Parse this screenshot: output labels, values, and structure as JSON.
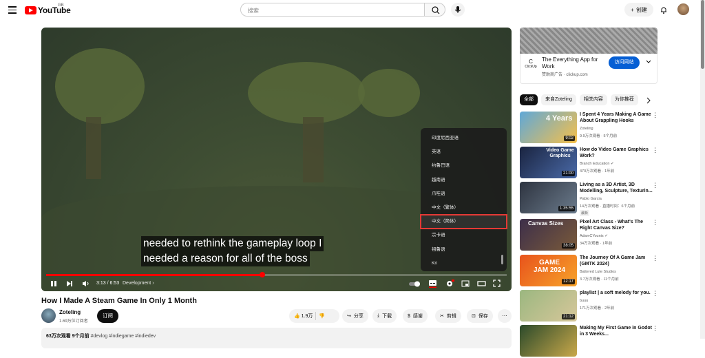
{
  "header": {
    "logo_text": "YouTube",
    "region": "GB",
    "search_placeholder": "搜索",
    "create_label": "创建"
  },
  "player": {
    "subtitle_line1": "needed to rethink the gameplay loop I",
    "subtitle_line2": "needed a reason for all of the boss",
    "current_time": "3:13 / 6:53",
    "chapter": "Development",
    "progress": 0.47,
    "settings_menu": {
      "items": [
        "印度尼西亚语",
        "英语",
        "约鲁巴语",
        "越南语",
        "爪哇语",
        "中文（繁体）",
        "中文（简体）",
        "宗卡语",
        "祖鲁语",
        "Kri"
      ],
      "selected_index": 6
    }
  },
  "video": {
    "title": "How I Made A Steam Game In Only 1 Month",
    "channel": "Zoteling",
    "subscribers": "1.69万位订阅者",
    "subscribe_label": "订阅",
    "like_count": "1.9万",
    "share_label": "分享",
    "download_label": "下载",
    "thanks_label": "感谢",
    "clip_label": "剪辑",
    "save_label": "保存",
    "views": "63万次观看",
    "date": "9个月前",
    "tags": "#devlog #indiegame #indiedev"
  },
  "ad": {
    "logo_label": "ClickUp",
    "title": "The Everything App for Work",
    "sponsor": "赞助商广告 · clickup.com",
    "cta": "访问网站"
  },
  "chips": [
    "全部",
    "来自Zoteling",
    "相关内容",
    "为你推荐"
  ],
  "recommendations": [
    {
      "title": "I Spent 4 Years Making A Game About Grappling Hooks",
      "channel": "Zoteling",
      "meta": "9.9万次观看 · 5个月前",
      "duration": "9:02",
      "thumb_text": "4 Years"
    },
    {
      "title": "How do Video Game Graphics Work?",
      "channel": "Branch Education",
      "meta": "470万次观看 · 1年前",
      "duration": "21:00",
      "thumb_text": "Video Game Graphics"
    },
    {
      "title": "Living as a 3D Artist, 3D Modelling, Sculpture, Texturin...",
      "channel": "Pablo Garcia",
      "meta": "14万次观看 · 直播时间：6个月前",
      "duration": "1:35:55",
      "badge": "最新",
      "thumb_text": ""
    },
    {
      "title": "Pixel Art Class - What's The Right Canvas Size?",
      "channel": "AdamCYounis",
      "meta": "34万次观看 · 1年前",
      "duration": "38:05",
      "thumb_text": "Canvas Sizes"
    },
    {
      "title": "The Journey Of A Game Jam (GMTK 2024)",
      "channel": "Battered Lute Studios",
      "meta": "3.7万次观看 · 11个月前",
      "duration": "12:17",
      "thumb_text": "GAME JAM 2024"
    },
    {
      "title": "playlist | a soft melody for you.",
      "channel": "buuu",
      "meta": "171万次观看 · 2年前",
      "duration": "21:12",
      "thumb_text": ""
    },
    {
      "title": "Making My First Game in Godot in 3 Weeks...",
      "channel": "",
      "meta": "",
      "duration": "",
      "thumb_text": ""
    }
  ]
}
